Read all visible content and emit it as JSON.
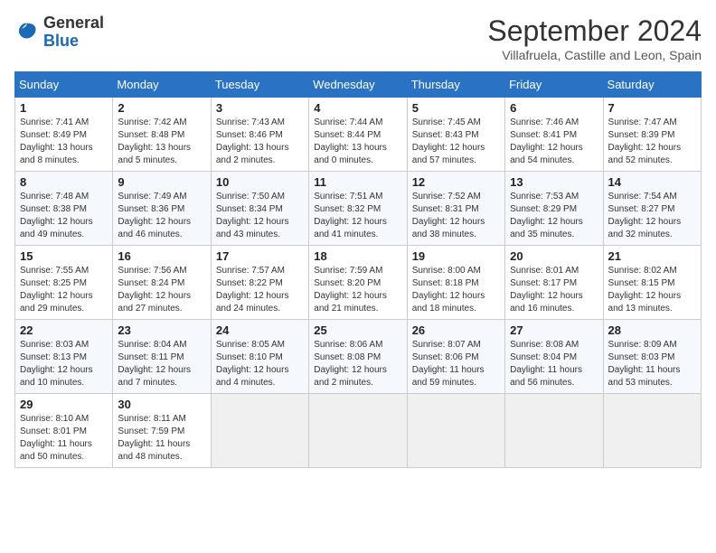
{
  "header": {
    "logo_general": "General",
    "logo_blue": "Blue",
    "month_title": "September 2024",
    "location": "Villafruela, Castille and Leon, Spain"
  },
  "calendar": {
    "headers": [
      "Sunday",
      "Monday",
      "Tuesday",
      "Wednesday",
      "Thursday",
      "Friday",
      "Saturday"
    ],
    "weeks": [
      [
        {
          "day": "1",
          "sunrise": "Sunrise: 7:41 AM",
          "sunset": "Sunset: 8:49 PM",
          "daylight": "Daylight: 13 hours and 8 minutes."
        },
        {
          "day": "2",
          "sunrise": "Sunrise: 7:42 AM",
          "sunset": "Sunset: 8:48 PM",
          "daylight": "Daylight: 13 hours and 5 minutes."
        },
        {
          "day": "3",
          "sunrise": "Sunrise: 7:43 AM",
          "sunset": "Sunset: 8:46 PM",
          "daylight": "Daylight: 13 hours and 2 minutes."
        },
        {
          "day": "4",
          "sunrise": "Sunrise: 7:44 AM",
          "sunset": "Sunset: 8:44 PM",
          "daylight": "Daylight: 13 hours and 0 minutes."
        },
        {
          "day": "5",
          "sunrise": "Sunrise: 7:45 AM",
          "sunset": "Sunset: 8:43 PM",
          "daylight": "Daylight: 12 hours and 57 minutes."
        },
        {
          "day": "6",
          "sunrise": "Sunrise: 7:46 AM",
          "sunset": "Sunset: 8:41 PM",
          "daylight": "Daylight: 12 hours and 54 minutes."
        },
        {
          "day": "7",
          "sunrise": "Sunrise: 7:47 AM",
          "sunset": "Sunset: 8:39 PM",
          "daylight": "Daylight: 12 hours and 52 minutes."
        }
      ],
      [
        {
          "day": "8",
          "sunrise": "Sunrise: 7:48 AM",
          "sunset": "Sunset: 8:38 PM",
          "daylight": "Daylight: 12 hours and 49 minutes."
        },
        {
          "day": "9",
          "sunrise": "Sunrise: 7:49 AM",
          "sunset": "Sunset: 8:36 PM",
          "daylight": "Daylight: 12 hours and 46 minutes."
        },
        {
          "day": "10",
          "sunrise": "Sunrise: 7:50 AM",
          "sunset": "Sunset: 8:34 PM",
          "daylight": "Daylight: 12 hours and 43 minutes."
        },
        {
          "day": "11",
          "sunrise": "Sunrise: 7:51 AM",
          "sunset": "Sunset: 8:32 PM",
          "daylight": "Daylight: 12 hours and 41 minutes."
        },
        {
          "day": "12",
          "sunrise": "Sunrise: 7:52 AM",
          "sunset": "Sunset: 8:31 PM",
          "daylight": "Daylight: 12 hours and 38 minutes."
        },
        {
          "day": "13",
          "sunrise": "Sunrise: 7:53 AM",
          "sunset": "Sunset: 8:29 PM",
          "daylight": "Daylight: 12 hours and 35 minutes."
        },
        {
          "day": "14",
          "sunrise": "Sunrise: 7:54 AM",
          "sunset": "Sunset: 8:27 PM",
          "daylight": "Daylight: 12 hours and 32 minutes."
        }
      ],
      [
        {
          "day": "15",
          "sunrise": "Sunrise: 7:55 AM",
          "sunset": "Sunset: 8:25 PM",
          "daylight": "Daylight: 12 hours and 29 minutes."
        },
        {
          "day": "16",
          "sunrise": "Sunrise: 7:56 AM",
          "sunset": "Sunset: 8:24 PM",
          "daylight": "Daylight: 12 hours and 27 minutes."
        },
        {
          "day": "17",
          "sunrise": "Sunrise: 7:57 AM",
          "sunset": "Sunset: 8:22 PM",
          "daylight": "Daylight: 12 hours and 24 minutes."
        },
        {
          "day": "18",
          "sunrise": "Sunrise: 7:59 AM",
          "sunset": "Sunset: 8:20 PM",
          "daylight": "Daylight: 12 hours and 21 minutes."
        },
        {
          "day": "19",
          "sunrise": "Sunrise: 8:00 AM",
          "sunset": "Sunset: 8:18 PM",
          "daylight": "Daylight: 12 hours and 18 minutes."
        },
        {
          "day": "20",
          "sunrise": "Sunrise: 8:01 AM",
          "sunset": "Sunset: 8:17 PM",
          "daylight": "Daylight: 12 hours and 16 minutes."
        },
        {
          "day": "21",
          "sunrise": "Sunrise: 8:02 AM",
          "sunset": "Sunset: 8:15 PM",
          "daylight": "Daylight: 12 hours and 13 minutes."
        }
      ],
      [
        {
          "day": "22",
          "sunrise": "Sunrise: 8:03 AM",
          "sunset": "Sunset: 8:13 PM",
          "daylight": "Daylight: 12 hours and 10 minutes."
        },
        {
          "day": "23",
          "sunrise": "Sunrise: 8:04 AM",
          "sunset": "Sunset: 8:11 PM",
          "daylight": "Daylight: 12 hours and 7 minutes."
        },
        {
          "day": "24",
          "sunrise": "Sunrise: 8:05 AM",
          "sunset": "Sunset: 8:10 PM",
          "daylight": "Daylight: 12 hours and 4 minutes."
        },
        {
          "day": "25",
          "sunrise": "Sunrise: 8:06 AM",
          "sunset": "Sunset: 8:08 PM",
          "daylight": "Daylight: 12 hours and 2 minutes."
        },
        {
          "day": "26",
          "sunrise": "Sunrise: 8:07 AM",
          "sunset": "Sunset: 8:06 PM",
          "daylight": "Daylight: 11 hours and 59 minutes."
        },
        {
          "day": "27",
          "sunrise": "Sunrise: 8:08 AM",
          "sunset": "Sunset: 8:04 PM",
          "daylight": "Daylight: 11 hours and 56 minutes."
        },
        {
          "day": "28",
          "sunrise": "Sunrise: 8:09 AM",
          "sunset": "Sunset: 8:03 PM",
          "daylight": "Daylight: 11 hours and 53 minutes."
        }
      ],
      [
        {
          "day": "29",
          "sunrise": "Sunrise: 8:10 AM",
          "sunset": "Sunset: 8:01 PM",
          "daylight": "Daylight: 11 hours and 50 minutes."
        },
        {
          "day": "30",
          "sunrise": "Sunrise: 8:11 AM",
          "sunset": "Sunset: 7:59 PM",
          "daylight": "Daylight: 11 hours and 48 minutes."
        },
        null,
        null,
        null,
        null,
        null
      ]
    ]
  }
}
